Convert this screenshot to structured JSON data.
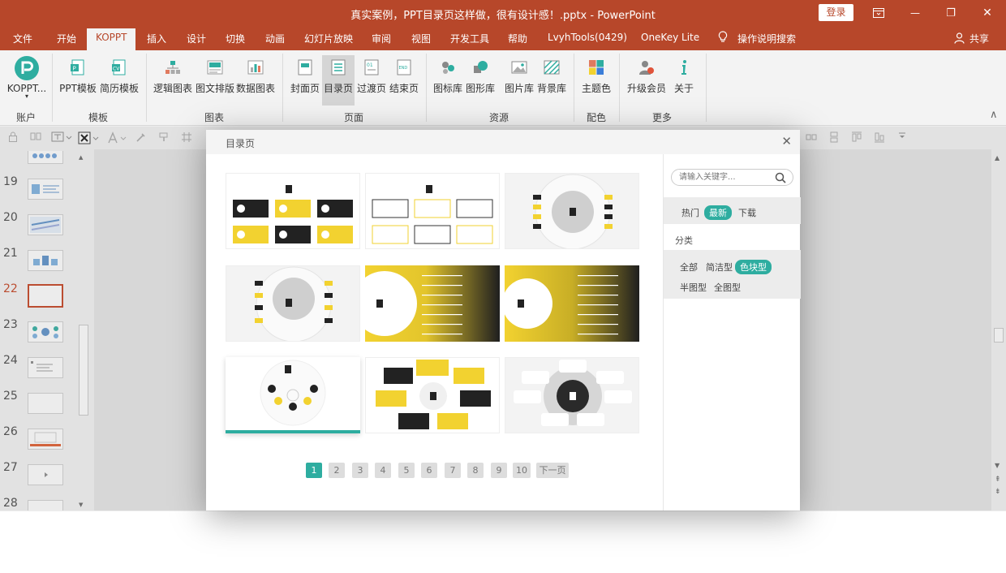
{
  "titlebar": {
    "title": "真实案例，PPT目录页这样做，很有设计感！.pptx  -  PowerPoint",
    "login": "登录",
    "minimize": "—",
    "restore": "❐",
    "close": "✕",
    "ribbon_display": "⊡"
  },
  "menu": {
    "tabs": [
      "文件",
      "开始",
      "KOPPT",
      "插入",
      "设计",
      "切换",
      "动画",
      "幻灯片放映",
      "审阅",
      "视图",
      "开发工具",
      "帮助",
      "LvyhTools(0429)",
      "OneKey Lite"
    ],
    "active": "KOPPT",
    "tell_me": "操作说明搜索",
    "share": "共享"
  },
  "ribbon": {
    "koppt": "KOPPT...",
    "koppt_caret": "▾",
    "buttons": [
      "PPT模板",
      "简历模板",
      "逻辑图表",
      "图文排版",
      "数据图表",
      "封面页",
      "目录页",
      "过渡页",
      "结束页",
      "图标库",
      "图形库",
      "图片库",
      "背景库",
      "主题色",
      "升级会员",
      "关于"
    ],
    "selected": "目录页",
    "groups": [
      "账户",
      "模板",
      "图表",
      "页面",
      "资源",
      "配色",
      "更多"
    ],
    "collapse": "∧"
  },
  "slides": {
    "numbers": [
      "19",
      "20",
      "21",
      "22",
      "23",
      "24",
      "25",
      "26",
      "27",
      "28"
    ],
    "current": "22",
    "scroll_up": "▲",
    "scroll_down": "▼"
  },
  "dialog": {
    "title": "目录页",
    "close": "✕",
    "card_label": "目",
    "pages": [
      "1",
      "2",
      "3",
      "4",
      "5",
      "6",
      "7",
      "8",
      "9",
      "10"
    ],
    "next": "下一页",
    "current_page": 1
  },
  "sidebar": {
    "search_placeholder": "请输入关键字...",
    "sort": [
      "热门",
      "最新",
      "下载"
    ],
    "sort_active": "最新",
    "category_title": "分类",
    "categories": [
      "全部",
      "简洁型",
      "色块型",
      "半图型",
      "全图型"
    ],
    "category_active": "色块型"
  },
  "colors": {
    "brand": "#b7472a",
    "accent": "#2eada0",
    "yellow": "#f2d230",
    "dark": "#2a2a2a"
  }
}
